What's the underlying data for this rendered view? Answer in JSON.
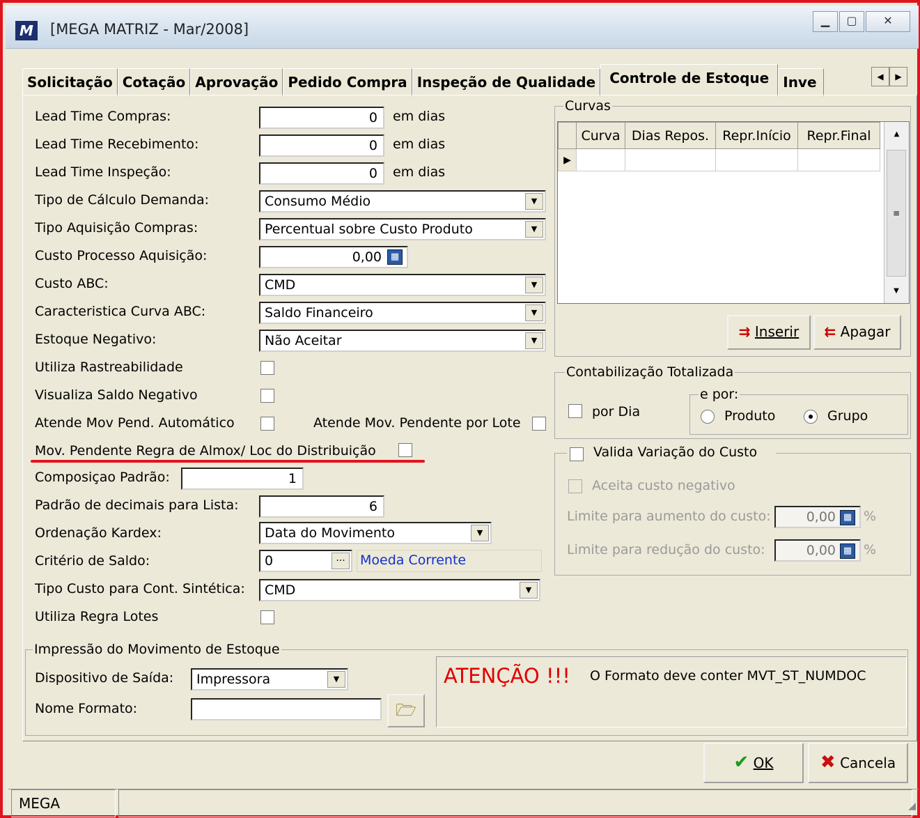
{
  "window": {
    "title": "[MEGA MATRIZ - Mar/2008]",
    "logo": "M"
  },
  "tabs": [
    "Solicitação",
    "Cotação",
    "Aprovação",
    "Pedido Compra",
    "Inspeção de Qualidade",
    "Controle de Estoque",
    "Inve"
  ],
  "active_tab": "Controle de Estoque",
  "form": {
    "lead_compras": {
      "label": "Lead Time Compras:",
      "value": "0",
      "unit": "em dias"
    },
    "lead_recebimento": {
      "label": "Lead Time Recebimento:",
      "value": "0",
      "unit": "em dias"
    },
    "lead_inspecao": {
      "label": "Lead Time Inspeção:",
      "value": "0",
      "unit": "em dias"
    },
    "tipo_calculo": {
      "label": "Tipo de Cálculo Demanda:",
      "value": "Consumo Médio"
    },
    "tipo_aquisicao": {
      "label": "Tipo Aquisição Compras:",
      "value": "Percentual sobre Custo Produto"
    },
    "custo_processo": {
      "label": "Custo Processo Aquisição:",
      "value": "0,00"
    },
    "custo_abc": {
      "label": "Custo ABC:",
      "value": "CMD"
    },
    "caracteristica_curva": {
      "label": "Caracteristica Curva ABC:",
      "value": "Saldo Financeiro"
    },
    "estoque_negativo": {
      "label": "Estoque Negativo:",
      "value": "Não Aceitar"
    },
    "utiliza_rastreabilidade": {
      "label": "Utiliza Rastreabilidade"
    },
    "visualiza_saldo_negativo": {
      "label": "Visualiza Saldo Negativo"
    },
    "atende_mov_pend_auto": {
      "label": "Atende Mov Pend. Automático"
    },
    "atende_mov_pend_lote": {
      "label": "Atende Mov. Pendente por Lote"
    },
    "mov_pendente_regra": {
      "label": "Mov. Pendente Regra de Almox/ Loc do Distribuição"
    },
    "composicao_padrao": {
      "label": "Composiçao Padrão:",
      "value": "1"
    },
    "padrao_decimais": {
      "label": "Padrão de decimais para Lista:",
      "value": "6"
    },
    "ordenacao_kardex": {
      "label": "Ordenação Kardex:",
      "value": "Data do Movimento"
    },
    "criterio_saldo": {
      "label": "Critério de Saldo:",
      "value": "0",
      "desc": "Moeda Corrente"
    },
    "tipo_custo_sintetica": {
      "label": "Tipo Custo para Cont. Sintética:",
      "value": "CMD"
    },
    "utiliza_regra_lotes": {
      "label": "Utiliza Regra Lotes"
    }
  },
  "curvas": {
    "title": "Curvas",
    "columns": [
      "Curva",
      "Dias Repos.",
      "Repr.Início",
      "Repr.Final"
    ],
    "inserir_label": "Inserir",
    "apagar_label": "Apagar"
  },
  "contabilizacao": {
    "title": "Contabilização Totalizada",
    "por_dia_label": "por Dia",
    "e_por_label": "e por:",
    "produto_label": "Produto",
    "grupo_label": "Grupo",
    "selected": "Grupo"
  },
  "valida_custo": {
    "title": "Valida Variação do Custo",
    "aceita_label": "Aceita custo negativo",
    "limite_aumento_label": "Limite para aumento do custo:",
    "limite_aumento_value": "0,00",
    "limite_reducao_label": "Limite para redução do custo:",
    "limite_reducao_value": "0,00",
    "percent": "%"
  },
  "impressao": {
    "title": "Impressão do Movimento de Estoque",
    "dispositivo_label": "Dispositivo de Saída:",
    "dispositivo_value": "Impressora",
    "nome_formato_label": "Nome Formato:",
    "nome_formato_value": "",
    "atencao": "ATENÇÃO !!!",
    "atencao_msg": "O Formato deve conter MVT_ST_NUMDOC"
  },
  "buttons": {
    "ok_label": "OK",
    "cancela_label": "Cancela"
  },
  "status": {
    "app": "MEGA"
  }
}
